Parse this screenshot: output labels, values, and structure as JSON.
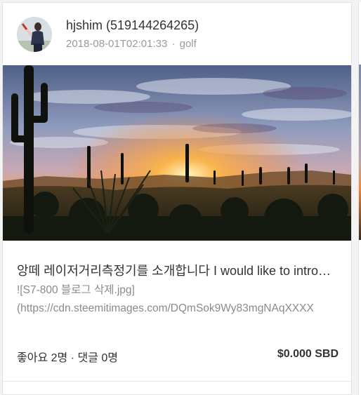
{
  "post": {
    "author_display": "hjshim (519144264265)",
    "timestamp": "2018-08-01T02:01:33",
    "meta_separator": "·",
    "tag": "golf",
    "title": "앙떼 레이저거리측정기를 소개합니다 I would like to introduce",
    "excerpt_line1": "![S7-800 블로그 삭제.jpg]",
    "excerpt_line2": "(https://cdn.steemitimages.com/DQmSok9Wy83mgNAqXXXX",
    "likes_label": "좋아요 2명",
    "stats_separator": "·",
    "comments_label": "댓글 0명",
    "payout": "$0.000 SBD"
  },
  "icons": {
    "avatar": "golfer-avatar",
    "thumbnail": "desert-sunset-photo"
  },
  "colors": {
    "text": "#333333",
    "muted": "#9a9a9a",
    "card_border": "#e2e2e2"
  }
}
